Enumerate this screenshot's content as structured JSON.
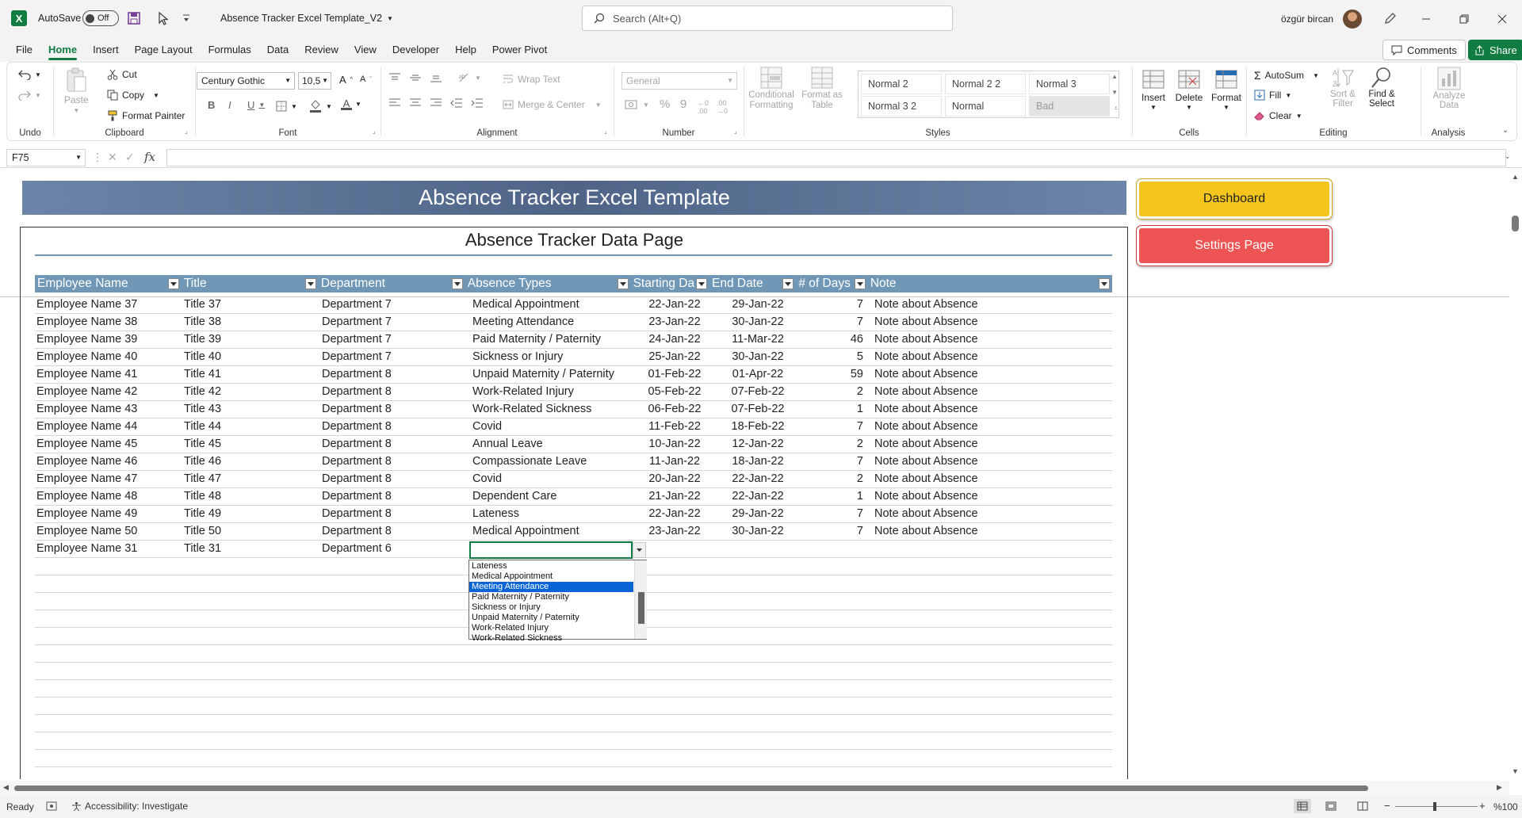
{
  "titlebar": {
    "autosave_label": "AutoSave",
    "autosave_state": "Off",
    "file_name": "Absence Tracker Excel Template_V2",
    "search_placeholder": "Search (Alt+Q)",
    "user_name": "özgür bircan"
  },
  "tabs": [
    "File",
    "Home",
    "Insert",
    "Page Layout",
    "Formulas",
    "Data",
    "Review",
    "View",
    "Developer",
    "Help",
    "Power Pivot"
  ],
  "active_tab": "Home",
  "comments_label": "Comments",
  "share_label": "Share",
  "ribbon": {
    "undo_group": "Undo",
    "clipboard": {
      "group": "Clipboard",
      "paste": "Paste",
      "cut": "Cut",
      "copy": "Copy",
      "format_painter": "Format Painter"
    },
    "font": {
      "group": "Font",
      "name": "Century Gothic",
      "size": "10,5"
    },
    "alignment": {
      "group": "Alignment",
      "wrap_text": "Wrap Text",
      "merge_center": "Merge & Center"
    },
    "number": {
      "group": "Number",
      "format": "General"
    },
    "styles": {
      "group": "Styles",
      "conditional_formatting_1": "Conditional",
      "conditional_formatting_2": "Formatting",
      "format_as_table_1": "Format as",
      "format_as_table_2": "Table",
      "style_boxes": [
        "Normal 2",
        "Normal 2 2",
        "Normal 3",
        "Normal 3 2",
        "Normal",
        "Bad"
      ]
    },
    "cells": {
      "group": "Cells",
      "insert": "Insert",
      "delete": "Delete",
      "format": "Format"
    },
    "editing": {
      "group": "Editing",
      "autosum": "AutoSum",
      "fill": "Fill",
      "clear": "Clear",
      "sort_filter_1": "Sort &",
      "sort_filter_2": "Filter",
      "find_select_1": "Find &",
      "find_select_2": "Select"
    },
    "analysis": {
      "group": "Analysis",
      "analyze_1": "Analyze",
      "analyze_2": "Data"
    }
  },
  "formula_bar": {
    "name_box": "F75",
    "formula": ""
  },
  "sheet": {
    "banner_title": "Absence Tracker Excel Template",
    "page_title": "Absence Tracker Data Page",
    "dashboard_button": "Dashboard",
    "settings_button": "Settings Page",
    "headers": [
      "Employee Name",
      "Title",
      "Department",
      "Absence Types",
      "Starting Da",
      "End Date",
      "# of Days",
      "Note"
    ],
    "rows": [
      [
        "Employee Name 37",
        "Title 37",
        "Department 7",
        "Medical Appointment",
        "22-Jan-22",
        "29-Jan-22",
        "7",
        "Note about Absence"
      ],
      [
        "Employee Name 38",
        "Title 38",
        "Department 7",
        "Meeting Attendance",
        "23-Jan-22",
        "30-Jan-22",
        "7",
        "Note about Absence"
      ],
      [
        "Employee Name 39",
        "Title 39",
        "Department 7",
        "Paid Maternity / Paternity",
        "24-Jan-22",
        "11-Mar-22",
        "46",
        "Note about Absence"
      ],
      [
        "Employee Name 40",
        "Title 40",
        "Department 7",
        "Sickness or Injury",
        "25-Jan-22",
        "30-Jan-22",
        "5",
        "Note about Absence"
      ],
      [
        "Employee Name 41",
        "Title 41",
        "Department 8",
        "Unpaid Maternity / Paternity",
        "01-Feb-22",
        "01-Apr-22",
        "59",
        "Note about Absence"
      ],
      [
        "Employee Name 42",
        "Title 42",
        "Department 8",
        "Work-Related Injury",
        "05-Feb-22",
        "07-Feb-22",
        "2",
        "Note about Absence"
      ],
      [
        "Employee Name 43",
        "Title 43",
        "Department 8",
        "Work-Related Sickness",
        "06-Feb-22",
        "07-Feb-22",
        "1",
        "Note about Absence"
      ],
      [
        "Employee Name 44",
        "Title 44",
        "Department 8",
        "Covid",
        "11-Feb-22",
        "18-Feb-22",
        "7",
        "Note about Absence"
      ],
      [
        "Employee Name 45",
        "Title 45",
        "Department 8",
        "Annual Leave",
        "10-Jan-22",
        "12-Jan-22",
        "2",
        "Note about Absence"
      ],
      [
        "Employee Name 46",
        "Title 46",
        "Department 8",
        "Compassionate Leave",
        "11-Jan-22",
        "18-Jan-22",
        "7",
        "Note about Absence"
      ],
      [
        "Employee Name 47",
        "Title 47",
        "Department 8",
        "Covid",
        "20-Jan-22",
        "22-Jan-22",
        "2",
        "Note about Absence"
      ],
      [
        "Employee Name 48",
        "Title 48",
        "Department 8",
        "Dependent Care",
        "21-Jan-22",
        "22-Jan-22",
        "1",
        "Note about Absence"
      ],
      [
        "Employee Name 49",
        "Title 49",
        "Department 8",
        "Lateness",
        "22-Jan-22",
        "29-Jan-22",
        "7",
        "Note about Absence"
      ],
      [
        "Employee Name 50",
        "Title 50",
        "Department 8",
        "Medical Appointment",
        "23-Jan-22",
        "30-Jan-22",
        "7",
        "Note about Absence"
      ],
      [
        "Employee Name 31",
        "Title 31",
        "Department 6",
        "",
        "",
        "",
        "",
        ""
      ]
    ],
    "dropdown_options": [
      "Lateness",
      "Medical Appointment",
      "Meeting Attendance",
      "Paid Maternity / Paternity",
      "Sickness or Injury",
      "Unpaid Maternity / Paternity",
      "Work-Related Injury",
      "Work-Related Sickness"
    ],
    "dropdown_selected": "Meeting Attendance"
  },
  "status": {
    "ready": "Ready",
    "accessibility": "Accessibility: Investigate",
    "zoom": "%100"
  },
  "colors": {
    "excel_green": "#107c41",
    "header_blue": "#7097b5",
    "dashboard_yellow": "#f4c51c",
    "settings_red": "#ee5454",
    "selection_blue": "#0a64d6"
  }
}
